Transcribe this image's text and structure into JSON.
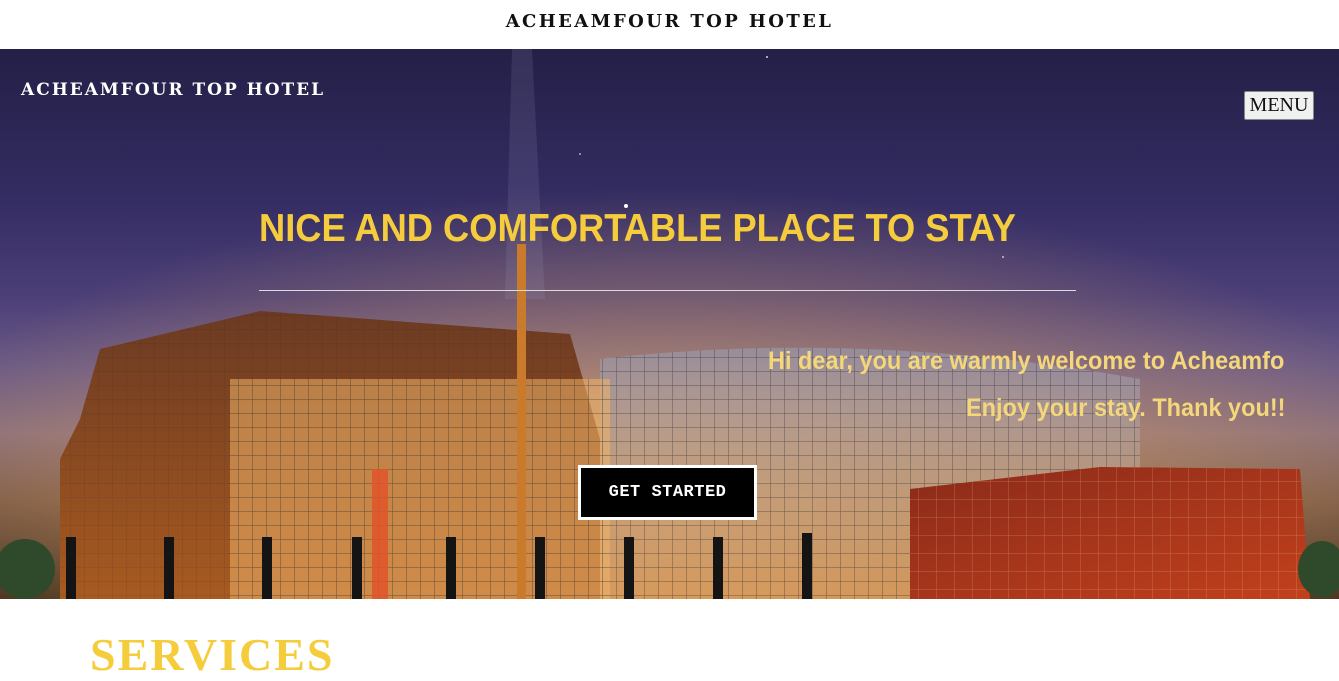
{
  "topbar": {
    "title": "ACHEAMFOUR TOP HOTEL"
  },
  "hero": {
    "brand": "ACHEAMFOUR TOP HOTEL",
    "menu_label": "MENU",
    "headline": "NICE AND COMFORTABLE PLACE TO STAY",
    "welcome_text": "Hi dear, you are warmly welcome to Acheamfo",
    "enjoy_text": "Enjoy your stay. Thank you!!",
    "cta_label": "GET STARTED"
  },
  "services": {
    "heading": "SERVICES"
  },
  "colors": {
    "accent_yellow": "#f5cd3c",
    "welcome_text": "#f3d77a",
    "sky_top": "#241f47",
    "cta_background": "#000000"
  }
}
